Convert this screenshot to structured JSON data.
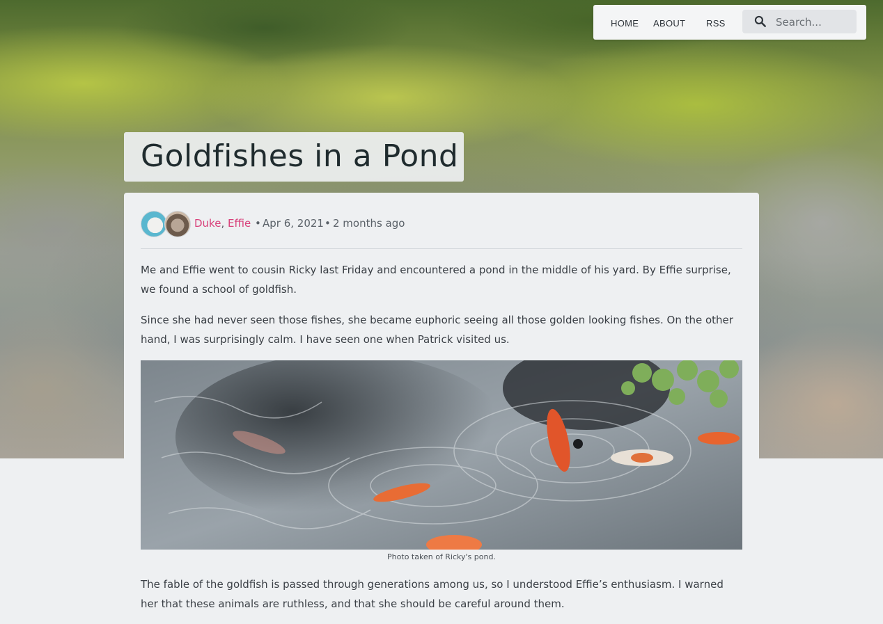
{
  "nav": {
    "home_label": "HOME",
    "about_label": "ABOUT",
    "rss_label": "RSS",
    "search_placeholder": "Search..."
  },
  "post": {
    "title": "Goldfishes in a Pond",
    "authors": [
      "Duke",
      "Effie"
    ],
    "date": "Apr 6, 2021",
    "relative_time": "2 months ago",
    "paragraphs": [
      "Me and Effie went to cousin Ricky last Friday and encountered a pond in the middle of his yard. By Effie surprise, we found a school of goldfish.",
      "Since she had never seen those fishes, she became euphoric seeing all those golden looking fishes. On the other hand, I was surprisingly calm. I have seen one when Patrick visited us.",
      "The fable of the goldfish is passed through generations among us, so I understood Effie’s enthusiasm. I warned her that these animals are ruthless, and that she should be careful around them."
    ],
    "figure_caption": "Photo taken of Ricky's pond."
  },
  "colors": {
    "author_link": "#d8407a",
    "page_background": "#eef0f2"
  }
}
